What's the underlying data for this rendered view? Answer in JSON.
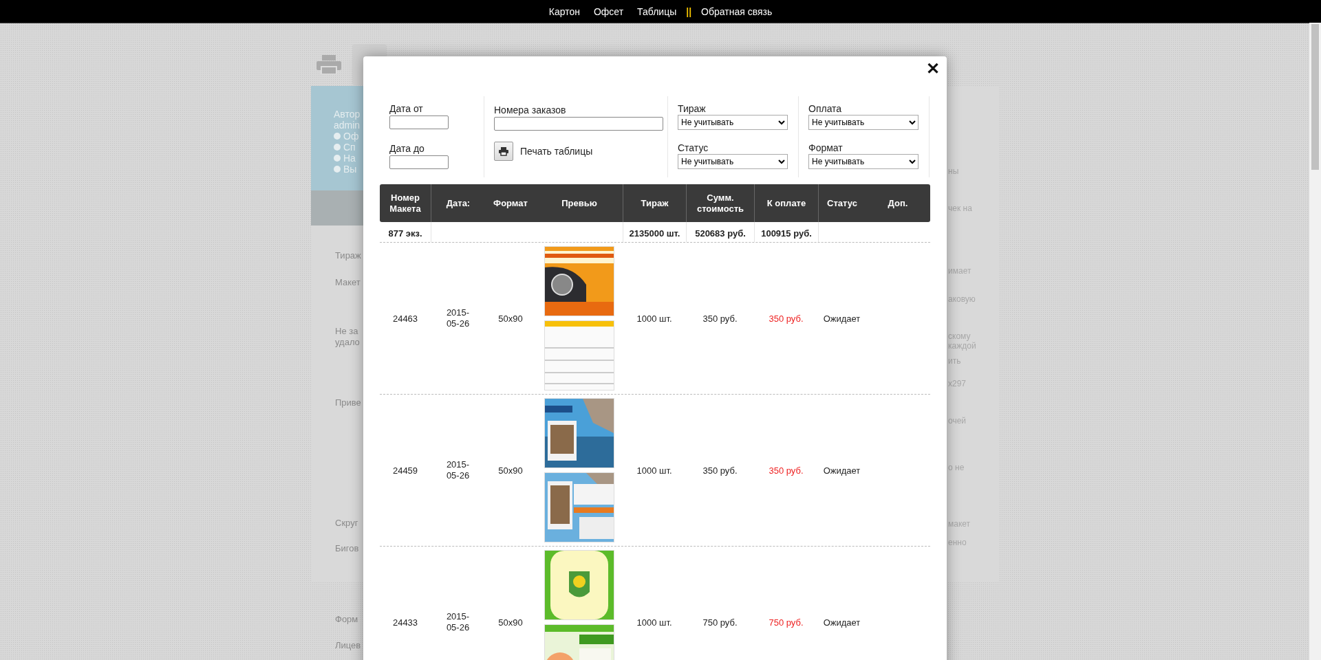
{
  "nav": [
    {
      "kind": "link",
      "label": "Картон"
    },
    {
      "kind": "link",
      "label": "Офсет"
    },
    {
      "kind": "link",
      "label": "Таблицы"
    },
    {
      "kind": "separator",
      "label": "||"
    },
    {
      "kind": "link",
      "label": "Обратная связь"
    }
  ],
  "background": {
    "sidebar": {
      "title": "Автор",
      "user": "admin",
      "items": [
        "Оф",
        "Сп",
        "На",
        "Вы"
      ]
    },
    "left_fragments": [
      "Тираж",
      "Макет",
      "Не за",
      "удало",
      "Приве",
      "Скруг",
      "Бигов",
      "Форм",
      "Лицев"
    ],
    "right_fragments": [
      "ны",
      "чек на",
      "имает",
      "аковую",
      "скому",
      "каждой",
      "ить",
      "х297",
      "очей",
      "о не",
      "макет",
      "енно"
    ]
  },
  "modal": {
    "close": "✕",
    "filters": {
      "date_from": {
        "label": "Дата от"
      },
      "date_to": {
        "label": "Дата до"
      },
      "orders": {
        "label": "Номера заказов"
      },
      "print": {
        "label": "Печать таблицы"
      },
      "selects": [
        {
          "label": "Тираж",
          "value": "Не учитывать"
        },
        {
          "label": "Статус",
          "value": "Не учитывать"
        },
        {
          "label": "Оплата",
          "value": "Не учитывать"
        },
        {
          "label": "Формат",
          "value": "Не учитывать"
        }
      ]
    },
    "table": {
      "columns": [
        "Номер Макета",
        "Дата:",
        "Формат",
        "Превью",
        "Тираж",
        "Сумм. стоимость",
        "К оплате",
        "Статус",
        "Доп."
      ],
      "summary": {
        "count": "877 экз.",
        "tiraz": "2135000 шт.",
        "sum": "520683 руб.",
        "pay": "100915 руб."
      },
      "rows": [
        {
          "number": "24463",
          "date": "2015-05-26",
          "format": "50x90",
          "tiraz": "1000 шт.",
          "sum": "350 руб.",
          "pay": "350 руб.",
          "status": "Ожидает"
        },
        {
          "number": "24459",
          "date": "2015-05-26",
          "format": "50x90",
          "tiraz": "1000 шт.",
          "sum": "350 руб.",
          "pay": "350 руб.",
          "status": "Ожидает"
        },
        {
          "number": "24433",
          "date": "2015-05-26",
          "format": "50x90",
          "tiraz": "1000 шт.",
          "sum": "750 руб.",
          "pay": "750 руб.",
          "status": "Ожидает"
        }
      ]
    }
  }
}
